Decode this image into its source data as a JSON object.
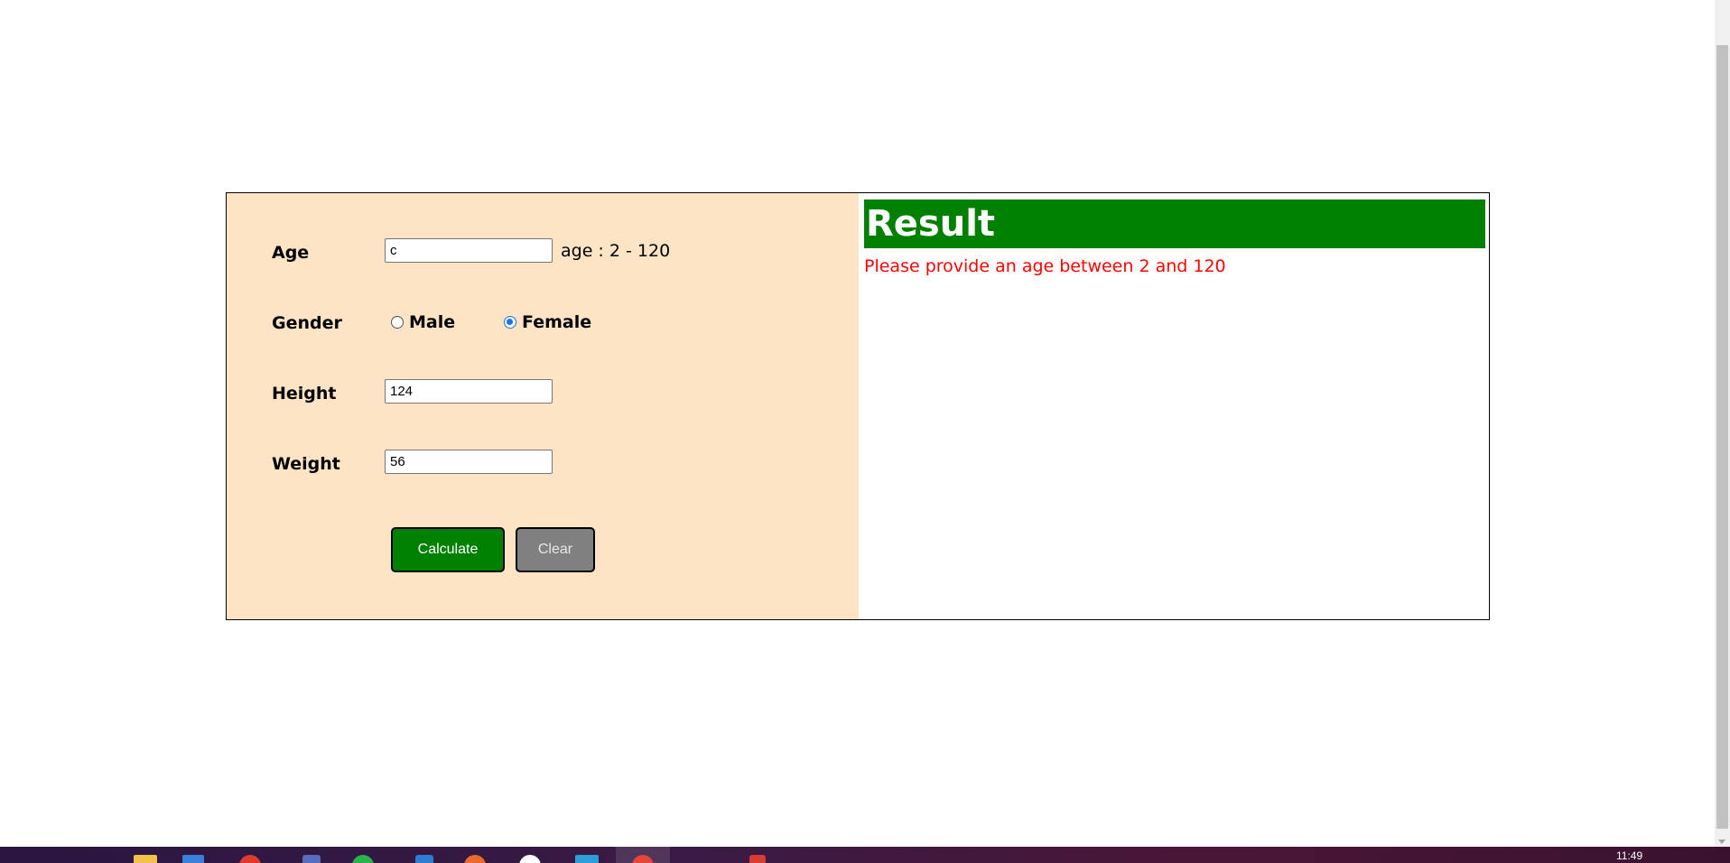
{
  "form": {
    "age": {
      "label": "Age",
      "value": "c",
      "hint": "age : 2 - 120"
    },
    "gender": {
      "label": "Gender",
      "options": [
        {
          "label": "Male",
          "checked": false
        },
        {
          "label": "Female",
          "checked": true
        }
      ]
    },
    "height": {
      "label": "Height",
      "value": "124"
    },
    "weight": {
      "label": "Weight",
      "value": "56"
    },
    "buttons": {
      "calculate": "Calculate",
      "clear": "Clear"
    }
  },
  "result": {
    "title": "Result",
    "message": "Please provide an age between 2 and 120"
  },
  "taskbar": {
    "clock": "11:49"
  },
  "colors": {
    "form_background": "#fce4c4",
    "result_header": "#008000",
    "error_text": "#ff0000",
    "calculate_button": "#008000",
    "clear_button": "#808080",
    "radio_accent": "#1a73e8"
  }
}
